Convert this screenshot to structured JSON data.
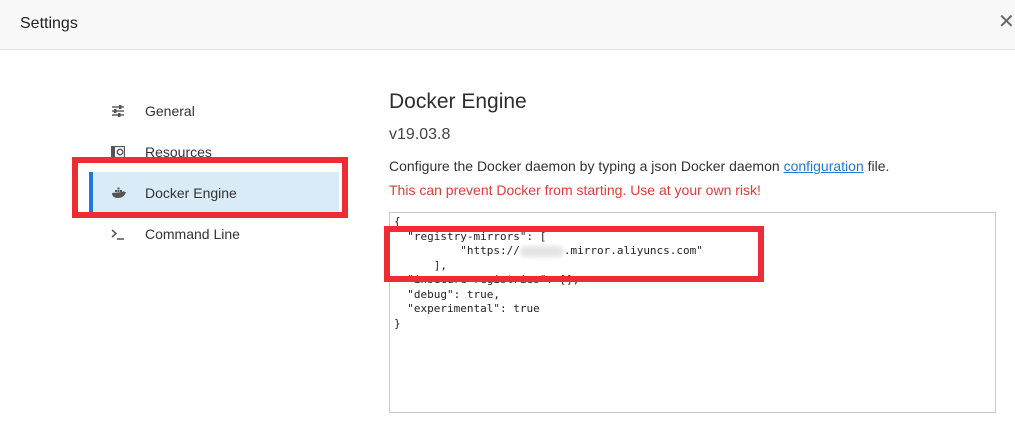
{
  "window": {
    "title": "Settings",
    "close_glyph": "✕"
  },
  "sidebar": {
    "items": [
      {
        "label": "General",
        "icon": "sliders-icon",
        "active": false
      },
      {
        "label": "Resources",
        "icon": "resources-icon",
        "active": false
      },
      {
        "label": "Docker Engine",
        "icon": "whale-icon",
        "active": true
      },
      {
        "label": "Command Line",
        "icon": "terminal-icon",
        "active": false
      }
    ]
  },
  "main": {
    "heading": "Docker Engine",
    "version": "v19.03.8",
    "desc_before": "Configure the Docker daemon by typing a json Docker daemon ",
    "desc_link": "configuration",
    "desc_after": " file.",
    "warning": "This can prevent Docker from starting. Use at your own risk!"
  },
  "editor": {
    "line1": "{",
    "line2": "  \"registry-mirrors\": [",
    "line3_prefix": "          \"https://",
    "line3_suffix": ".mirror.aliyuncs.com\"",
    "line4": "      ],",
    "line5": "  \"insecure-registries\": [],",
    "line6": "  \"debug\": true,",
    "line7": "  \"experimental\": true",
    "line8": "}"
  },
  "colors": {
    "accent": "#1d7ad8",
    "warning": "#e23b34",
    "highlight": "#ef2b33",
    "active_bg": "#d9ebf7"
  }
}
